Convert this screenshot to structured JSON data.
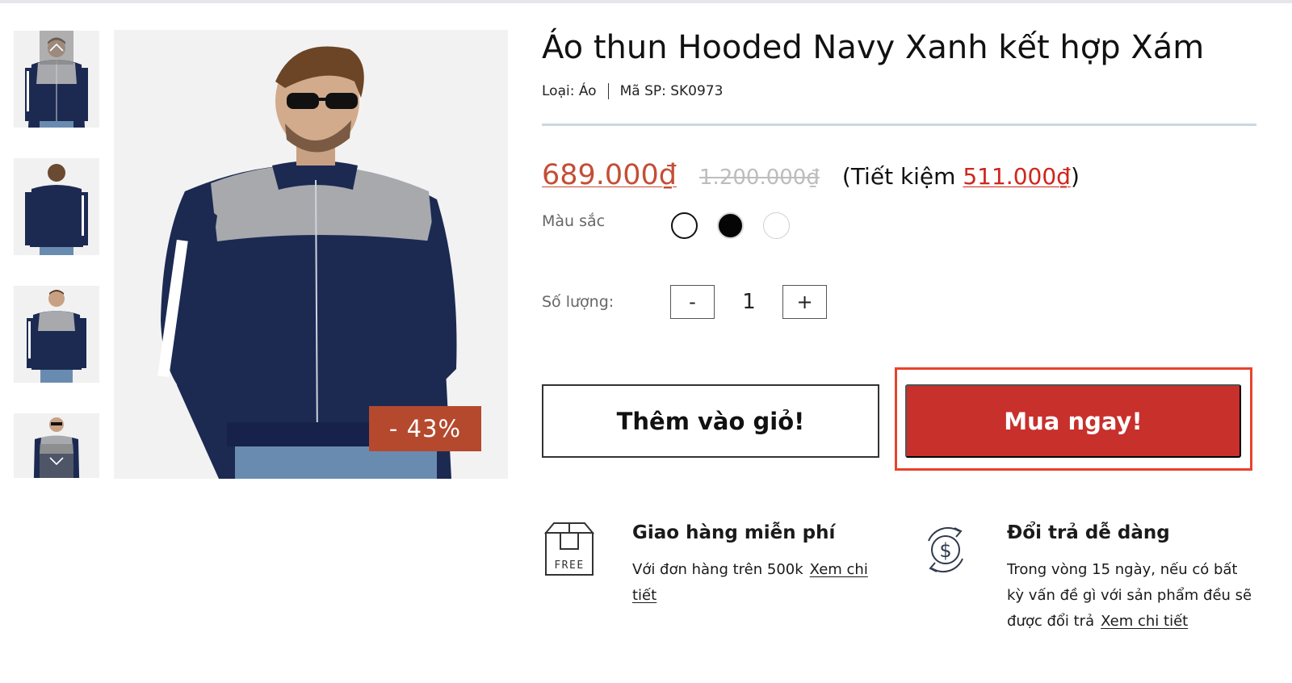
{
  "product": {
    "title": "Áo thun Hooded Navy Xanh kết hợp Xám",
    "type_text": "Loại: Áo",
    "sku_text": "Mã SP: SK0973",
    "discount_badge": "- 43%"
  },
  "pricing": {
    "current_price": "689.000₫",
    "old_price": "1.200.000₫",
    "savings_prefix": "(Tiết kiệm ",
    "savings_amount": "511.000₫",
    "savings_suffix": ")"
  },
  "options": {
    "color_label": "Màu sắc",
    "swatches": [
      {
        "color": "#ffffff",
        "selected": true
      },
      {
        "color": "#050505",
        "selected": false
      },
      {
        "color": "#ffffff",
        "selected": false
      }
    ],
    "quantity_label": "Số lượng:",
    "quantity_minus": "-",
    "quantity_value": "1",
    "quantity_plus": "+"
  },
  "actions": {
    "add_to_cart": "Thêm vào giỏ!",
    "buy_now": "Mua ngay!"
  },
  "features": {
    "shipping": {
      "icon": "free-box-icon",
      "icon_text": "FREE",
      "title": "Giao hàng miễn phí",
      "desc": "Với đơn hàng trên 500k",
      "link": "Xem chi tiết"
    },
    "returns": {
      "icon": "dollar-exchange-icon",
      "title": "Đổi trả dễ dàng",
      "desc": "Trong vòng 15 ngày, nếu có bất kỳ vấn đề gì với sản phẩm đều sẽ được đổi trả",
      "link": "Xem chi tiết"
    }
  },
  "colors": {
    "price_accent": "#c44e36",
    "savings_accent": "#d0251c",
    "buy_button": "#c8302c",
    "highlight_border": "#e8432b",
    "badge_bg": "#b5492e",
    "rule_blue": "#c9d8e6",
    "jacket_navy": "#1c2a52",
    "jacket_grey": "#a7a9ad"
  }
}
